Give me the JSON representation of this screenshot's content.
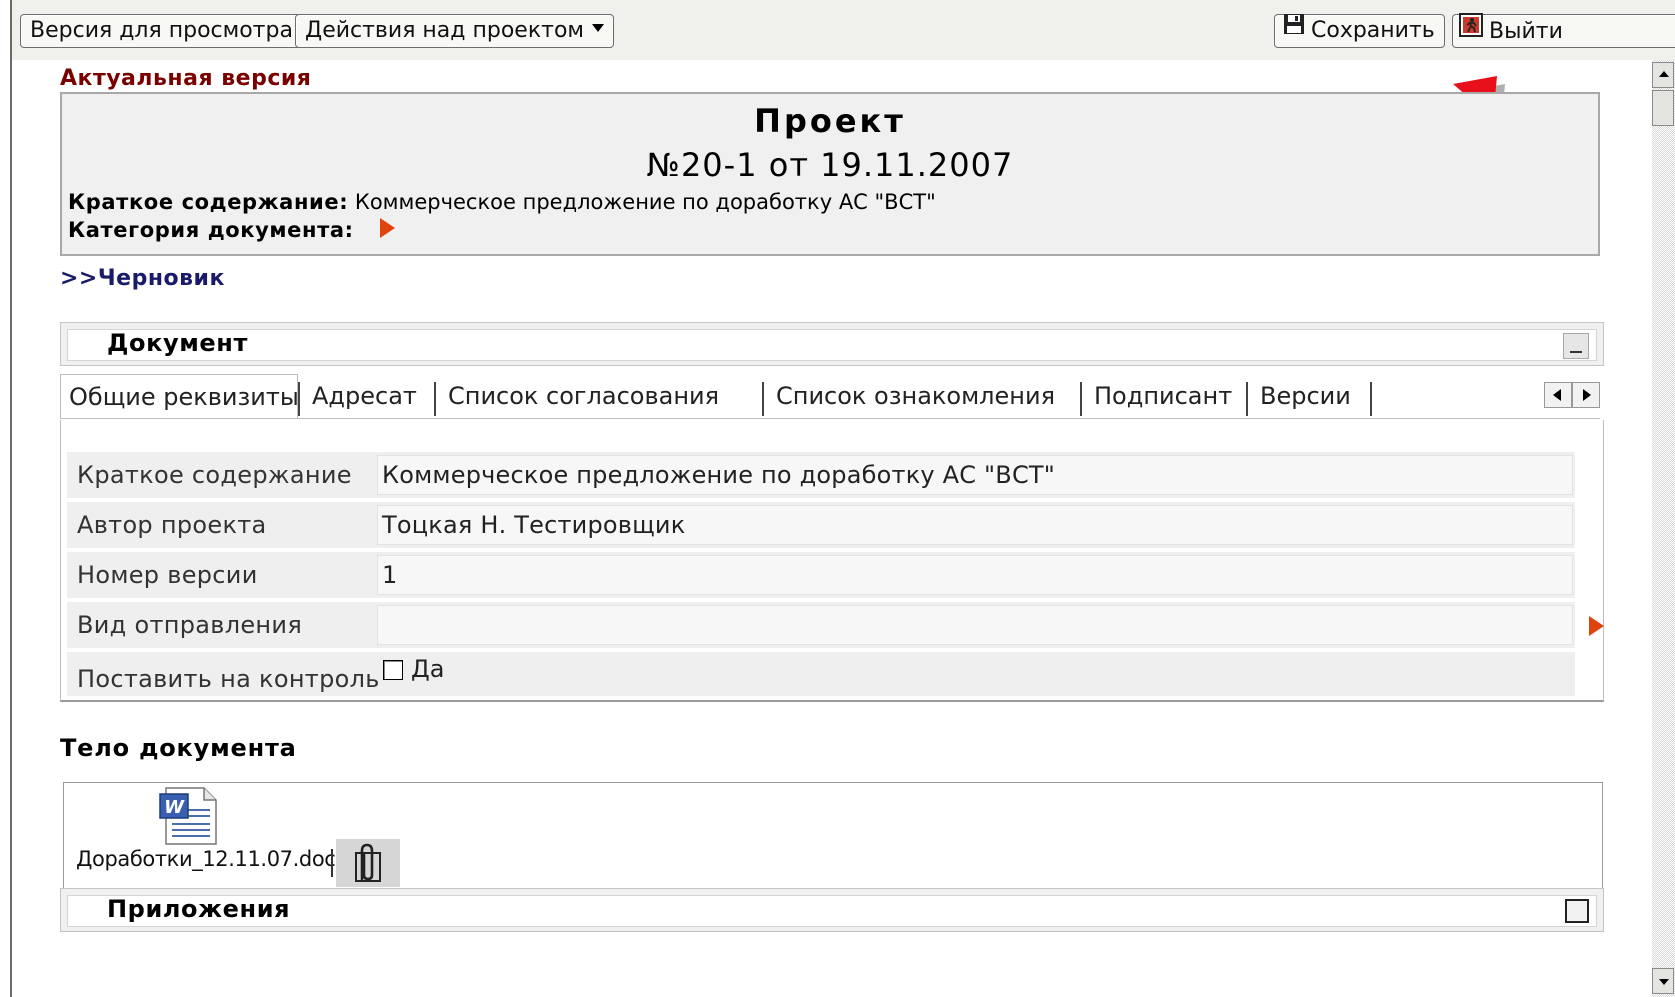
{
  "toolbar": {
    "view_version": "Версия для просмотра",
    "project_actions": "Действия над проектом",
    "save": "Сохранить",
    "exit": "Выйти"
  },
  "header": {
    "version_label": "Актуальная версия",
    "title": "Проект",
    "number": "№20-1 от 19.11.2007",
    "summary_label": "Краткое содержание:",
    "summary_value": "Коммерческое предложение по доработку АС \"ВСТ\"",
    "category_label": "Категория документа:",
    "draft_link": ">>Черновик"
  },
  "document_section": {
    "title": "Документ",
    "tabs": [
      {
        "label": "Общие реквизиты",
        "active": true
      },
      {
        "label": "Адресат"
      },
      {
        "label": "Список согласования"
      },
      {
        "label": "Список ознакомления"
      },
      {
        "label": "Подписант"
      },
      {
        "label": "Версии"
      }
    ],
    "fields": [
      {
        "label": "Краткое содержание",
        "value": "Коммерческое предложение по доработку АС \"ВСТ\""
      },
      {
        "label": "Автор проекта",
        "value": "Тоцкая Н. Тестировщик"
      },
      {
        "label": "Номер версии",
        "value": "1"
      },
      {
        "label": "Вид отправления",
        "value": ""
      },
      {
        "label": "Поставить на контроль",
        "checkbox_label": "Да",
        "checked": false
      }
    ]
  },
  "body": {
    "title": "Тело документа",
    "file_name": "Доработки_12.11.07.doc"
  },
  "attachments": {
    "title": "Приложения"
  },
  "colors": {
    "accent_orange": "#e0440e",
    "version_label": "#7a0000",
    "draft_link": "#1a1a6a",
    "arrow_red": "#e8101a"
  }
}
